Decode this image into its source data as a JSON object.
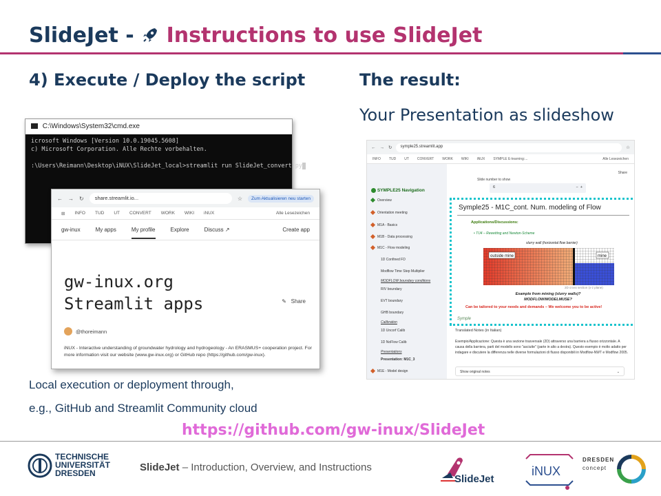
{
  "header": {
    "title_part1": "SlideJet - ",
    "title_icon": "rocket-icon",
    "title_part2": " Instructions to use SlideJet",
    "accent_color": "#b3336f",
    "primary_color": "#1b3a5c"
  },
  "left": {
    "heading": "4) Execute / Deploy the script",
    "cmd": {
      "window_title": "C:\\Windows\\System32\\cmd.exe",
      "lines": [
        "icrosoft Windows [Version 10.0.19045.5608]",
        "c) Microsoft Corporation. Alle Rechte vorbehalten.",
        "",
        ":\\Users\\Reimann\\Desktop\\iNUX\\SlideJet_local>streamlit run SlideJet_convert.py"
      ]
    },
    "browser": {
      "url": "share.streamlit.io...",
      "update_badge": "Zum Aktualisieren neu starten",
      "bookmarks": [
        "INFO",
        "TUD",
        "UT",
        "CONVERT",
        "WORK",
        "WIKI",
        "iNUX"
      ],
      "bookmarks_right": "Alle Lesezeichen",
      "workspace": "gw-inux",
      "nav": [
        "My apps",
        "My profile",
        "Explore",
        "Discuss ↗"
      ],
      "nav_right": "Create app",
      "headline_line1": "gw-inux.org",
      "headline_line2": "Streamlit apps",
      "share_label": "Share",
      "user": "@thoreimann",
      "description": "iNUX - Interactive understanding of groundwater hydrology and hydrogeology - An ERASMUS+ cooperation project. For more information visit our website (www.gw-inux.org) or GitHub repo (https://github.com/gw-inux)."
    },
    "body_line1": "Local execution or deployment through,",
    "body_line2": "e.g., GitHub and Streamlit Community cloud"
  },
  "right": {
    "heading": "The result:",
    "subheading": "Your Presentation as slideshow",
    "screenshot": {
      "url": "symple25.streamlit.app",
      "bookmarks": [
        "INFO",
        "TUD",
        "UT",
        "CONVERT",
        "WORK",
        "WIKI",
        "iNUX",
        "SYMPLE E-learning:..."
      ],
      "bookmarks_right": "Alle Lesezeichen",
      "share": "Share",
      "nav_title": "SYMPLE25 Navigation",
      "nav_items": [
        "Overview",
        "Orientation meeting",
        "M1A - Basics",
        "M1B - Data processing",
        "M1C - Flow modeling"
      ],
      "nav_sub": [
        "1D Confined FD",
        "Modflow Time Step Multiplier",
        "MODFLOW boundary conditions",
        "RIV boundary",
        "EVT boundary",
        "GHB boundary",
        "Calibration",
        "1D Uncorf Calib",
        "1D NoFlow Calib",
        "Presentations",
        "Presentation: M1C_3"
      ],
      "nav_last": "M1E - Model design",
      "slide_number_label": "Slide number to show",
      "slide_number": "6",
      "slide_title": "Symple25 - M1C_cont. Num. modeling of Flow",
      "slide_apps": "Applications/Discussions:",
      "slide_bullet": "TU4 – Rewetting and Newton-Scheme",
      "slide_caption": "slurry wall (horizontal flow barrier)",
      "label_outside": "outside mine",
      "label_mine": "mine",
      "slide_section": "2D cross section (x-z plane)",
      "slide_question_1": "Example from mining (slurry walls)?",
      "slide_question_2": "MODFLOW/MODELMUSE?",
      "slide_call": "Can be tailored to your needs and demands – We welcome you to be active!",
      "slide_logo": "Symple",
      "notes_heading": "Translated Notes (in Italian)",
      "notes_text": "Esempio/Applicazione: Questa è una sezione trasversale (2D) attraverso una barriera a flusso orizzontale. A causa della barriera, parti del modello sono \"asciutte\" (parte in alto a destra). Questo esempio è molto adatto per indagare e discutere la differenza nelle diverse formulazioni di flusso disponibili in Modflow-NWT e Modflow 2005.",
      "show_notes": "Show original notes"
    }
  },
  "link": "https://github.com/gw-inux/SlideJet",
  "footer": {
    "tud_line1": "TECHNISCHE",
    "tud_line2": "UNIVERSITÄT",
    "tud_line3": "DRESDEN",
    "title_bold": "SlideJet",
    "title_rest": " – Introduction, Overview, and Instructions",
    "slidejet_logo_text": "SlideJet",
    "inux_logo_text": "iNUX",
    "dresden_line1": "DRESDEN",
    "dresden_line2": "concept"
  }
}
